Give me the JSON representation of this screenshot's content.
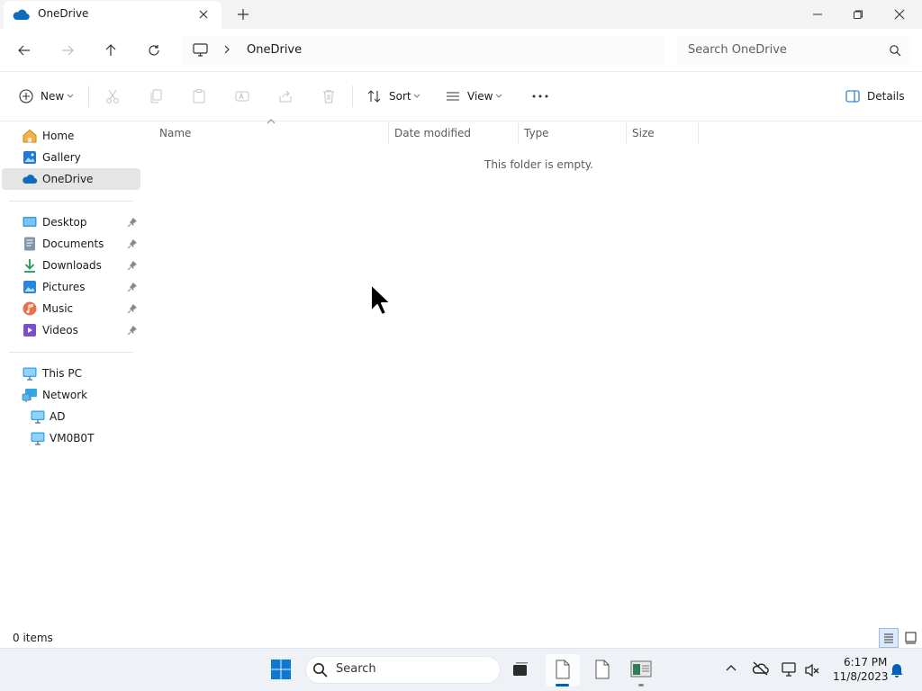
{
  "window": {
    "tab_title": "OneDrive",
    "minimize_glyph": "—",
    "maximize_glyph": "restore",
    "close_glyph": "×",
    "new_tab_glyph": "+"
  },
  "address": {
    "breadcrumb": "OneDrive",
    "search_placeholder": "Search OneDrive"
  },
  "commands": {
    "new_label": "New",
    "sort_label": "Sort",
    "view_label": "View",
    "more_label": "...",
    "details_label": "Details"
  },
  "nav": {
    "top": [
      {
        "label": "Home",
        "icon": "home-icon"
      },
      {
        "label": "Gallery",
        "icon": "gallery-icon"
      },
      {
        "label": "OneDrive",
        "icon": "onedrive-icon",
        "selected": true
      }
    ],
    "quick_access": [
      {
        "label": "Desktop",
        "icon": "desktop-icon",
        "pinned": true
      },
      {
        "label": "Documents",
        "icon": "documents-icon",
        "pinned": true
      },
      {
        "label": "Downloads",
        "icon": "downloads-icon",
        "pinned": true
      },
      {
        "label": "Pictures",
        "icon": "pictures-icon",
        "pinned": true
      },
      {
        "label": "Music",
        "icon": "music-icon",
        "pinned": true
      },
      {
        "label": "Videos",
        "icon": "videos-icon",
        "pinned": true
      }
    ],
    "devices": [
      {
        "label": "This PC",
        "icon": "this-pc-icon"
      },
      {
        "label": "Network",
        "icon": "network-icon"
      },
      {
        "label": "AD",
        "icon": "computer-icon"
      },
      {
        "label": "VM0B0T",
        "icon": "computer-icon"
      }
    ]
  },
  "content": {
    "columns": [
      "Name",
      "Date modified",
      "Type",
      "Size"
    ],
    "empty_message": "This folder is empty."
  },
  "status": {
    "item_count": "0 items"
  },
  "taskbar": {
    "search_label": "Search",
    "time": "6:17 PM",
    "date": "11/8/2023"
  },
  "colors": {
    "accent": "#005fb8",
    "selected_nav": "#e5e5e5",
    "onedrive_blue": "#0f6cbd"
  }
}
